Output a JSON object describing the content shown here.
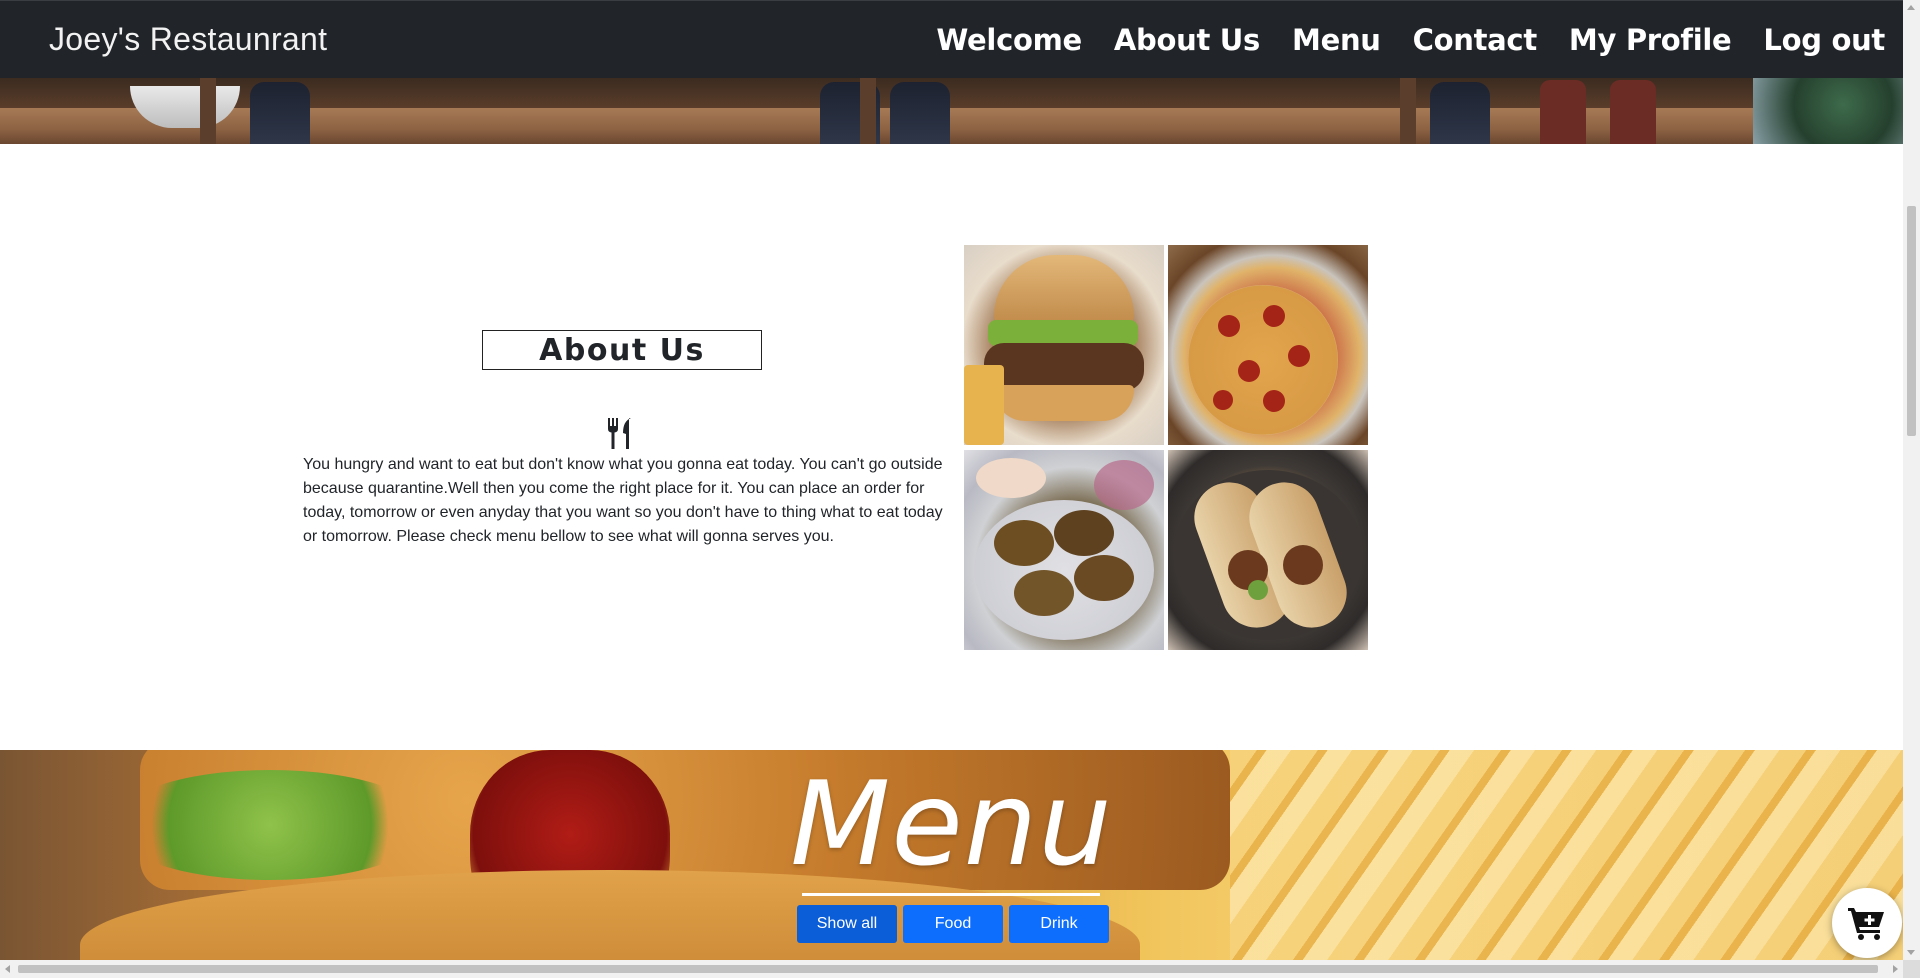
{
  "navbar": {
    "brand": "Joey's Restaunrant",
    "links": [
      "Welcome",
      "About Us",
      "Menu",
      "Contact",
      "My Profile",
      "Log out"
    ]
  },
  "about": {
    "title": "About Us",
    "icon": "utensils-icon",
    "text": "You hungry and want to eat but don't know what you gonna eat today. You can't go outside because quarantine.Well then you come the right place for it. You can place an order for today, tomorrow or even anyday that you want so you don't have to thing what to eat today or tomorrow. Please check menu bellow to see what will gonna serves you."
  },
  "gallery": {
    "images": [
      "burger-image",
      "pizza-image",
      "falafel-image",
      "wrap-image"
    ]
  },
  "menu": {
    "title": "Menu",
    "filters": [
      "Show all",
      "Food",
      "Drink"
    ]
  },
  "cart": {
    "icon": "cart-plus-icon"
  },
  "colors": {
    "navbar": "#212529",
    "button": "#0d6efd",
    "text": "#212529"
  }
}
